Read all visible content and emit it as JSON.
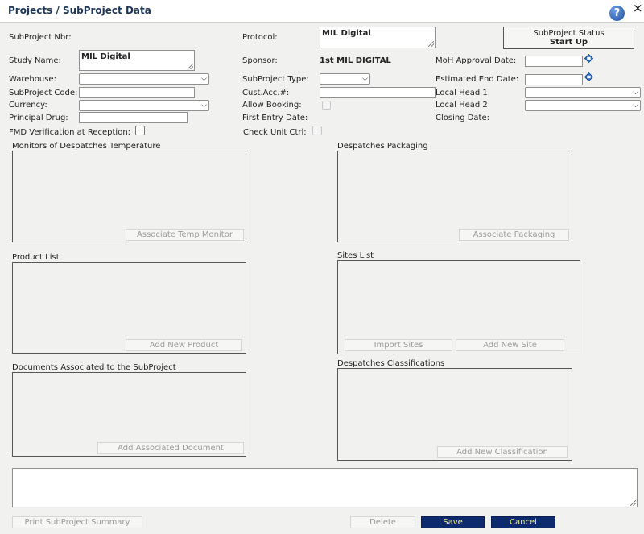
{
  "window": {
    "title": "Projects / SubProject Data",
    "help_icon": "help-icon",
    "close_icon": "×"
  },
  "form": {
    "subproject_nbr": {
      "label": "SubProject Nbr:"
    },
    "protocol": {
      "label": "Protocol:",
      "value": "MIL Digital"
    },
    "status": {
      "label": "SubProject Status",
      "value": "Start Up"
    },
    "study_name": {
      "label": "Study Name:",
      "value": "MIL Digital"
    },
    "sponsor": {
      "label": "Sponsor:",
      "value": "1st MIL DIGITAL"
    },
    "moh_approval_date": {
      "label": "MoH Approval Date:",
      "value": ""
    },
    "warehouse": {
      "label": "Warehouse:",
      "value": ""
    },
    "subproject_type": {
      "label": "SubProject Type:",
      "value": ""
    },
    "estimated_end_date": {
      "label": "Estimated End Date:",
      "value": ""
    },
    "subproject_code": {
      "label": "SubProject Code:",
      "value": ""
    },
    "cust_acc": {
      "label": "Cust.Acc.#:",
      "value": ""
    },
    "local_head_1": {
      "label": "Local Head 1:",
      "value": ""
    },
    "currency": {
      "label": "Currency:",
      "value": ""
    },
    "allow_booking": {
      "label": "Allow Booking:",
      "checked": false
    },
    "local_head_2": {
      "label": "Local Head 2:",
      "value": ""
    },
    "principal_drug": {
      "label": "Principal Drug:",
      "value": ""
    },
    "first_entry_date": {
      "label": "First Entry Date:"
    },
    "closing_date": {
      "label": "Closing Date:"
    },
    "fmd_verification": {
      "label": "FMD Verification at Reception:",
      "checked": false
    },
    "check_unit_ctrl": {
      "label": "Check Unit Ctrl:",
      "checked": false
    }
  },
  "sections": {
    "temp_monitors": {
      "title": "Monitors of Despatches Temperature",
      "button": "Associate Temp Monitor"
    },
    "packaging": {
      "title": "Despatches Packaging",
      "button": "Associate Packaging"
    },
    "products": {
      "title": "Product List",
      "button": "Add New Product"
    },
    "sites": {
      "title": "Sites List",
      "button_import": "Import Sites",
      "button_add": "Add New Site"
    },
    "documents": {
      "title": "Documents Associated to the SubProject",
      "button": "Add Associated Document"
    },
    "classifications": {
      "title": "Despatches Classifications",
      "button": "Add New Classification"
    }
  },
  "footer": {
    "print_summary": "Print SubProject Summary",
    "delete": "Delete",
    "save": "Save",
    "cancel": "Cancel"
  },
  "colors": {
    "primary_button_bg": "#0d2a6e",
    "primary_button_text": "#f7ef7a",
    "title_text": "#1e3657"
  }
}
